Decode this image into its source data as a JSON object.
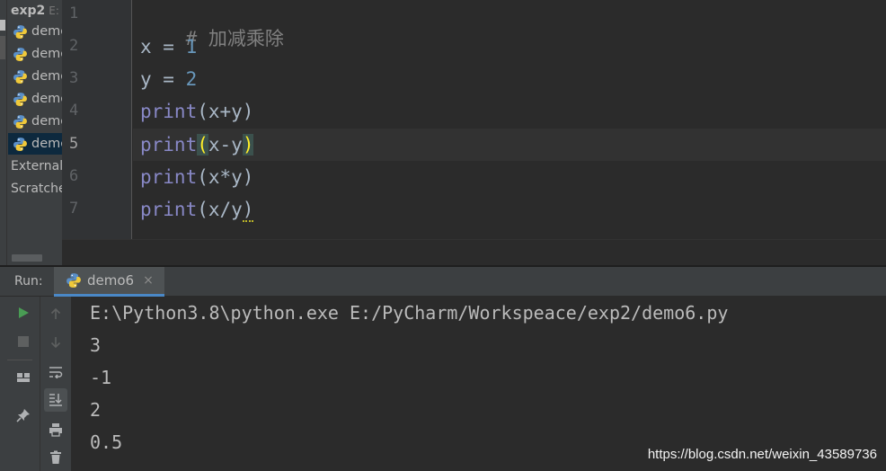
{
  "project": {
    "root": "exp2",
    "root_path": "E:",
    "files": [
      "demo",
      "demo",
      "demo",
      "demo",
      "demo",
      "demo"
    ],
    "selected_index": 5,
    "external": "External",
    "scratches": "Scratche"
  },
  "editor": {
    "current_line": 5,
    "line_numbers": [
      "1",
      "2",
      "3",
      "4",
      "5",
      "6",
      "7"
    ],
    "lines": {
      "l1_comment": "# 加减乘除",
      "l2_var": "x",
      "l2_eq": " = ",
      "l2_val": "1",
      "l3_var": "y",
      "l3_eq": " = ",
      "l3_val": "2",
      "l4_fn": "print",
      "l4_args": "(x+y)",
      "l5_fn": "print",
      "l5_open": "(",
      "l5_args": "x-y",
      "l5_close": ")",
      "l6_fn": "print",
      "l6_args": "(x*y)",
      "l7_fn": "print",
      "l7_args": "(x/y",
      "l7_close": ")"
    }
  },
  "run": {
    "label": "Run:",
    "tab_label": "demo6",
    "tab_close": "×",
    "output": [
      "E:\\Python3.8\\python.exe E:/PyCharm/Workspeace/exp2/demo6.py",
      "3",
      "-1",
      "2",
      "0.5"
    ]
  },
  "watermark": "https://blog.csdn.net/weixin_43589736",
  "colors": {
    "background": "#2b2b2b",
    "panel": "#3c3f41",
    "keyword_fn": "#8888c6",
    "number": "#6897bb",
    "comment": "#808080",
    "brace_match": "#ffef28",
    "run_green": "#499c54",
    "tab_underline": "#4a88c7"
  },
  "icons": {
    "python_file": "python-file-icon",
    "run": "run-icon",
    "stop": "stop-icon",
    "layout": "layout-icon",
    "pin": "pin-icon",
    "up": "arrow-up-icon",
    "down": "arrow-down-icon",
    "wrap": "soft-wrap-icon",
    "scroll_end": "scroll-to-end-icon",
    "print": "print-icon",
    "trash": "trash-icon"
  }
}
